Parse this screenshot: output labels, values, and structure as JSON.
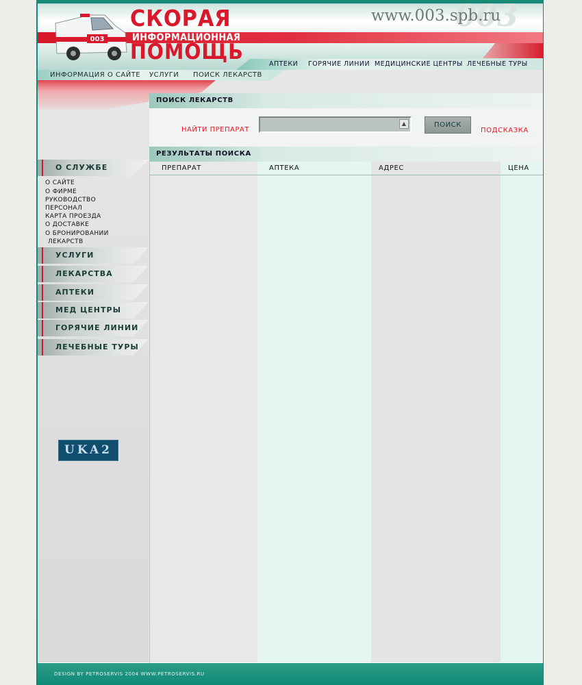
{
  "header": {
    "logo_top": "СКОРАЯ",
    "logo_middle": "ИНФОРМАЦИОННАЯ",
    "logo_bottom": "ПОМОЩЬ",
    "ambulance_number": "003",
    "site_url": "www.003.spb.ru",
    "url_watermark": "003",
    "topnav": [
      "АПТЕКИ",
      "ГОРЯЧИЕ ЛИНИИ",
      "МЕДИЦИНСКИЕ ЦЕНТРЫ",
      "ЛЕЧЕБНЫЕ ТУРЫ"
    ]
  },
  "subnav": [
    "ИНФОРМАЦИЯ О САЙТЕ",
    "УСЛУГИ",
    "ПОИСК ЛЕКАРСТВ"
  ],
  "sidebar": {
    "service_heading": "О СЛУЖБЕ",
    "service_links": [
      "О САЙТЕ",
      "О ФИРМЕ",
      "РУКОВОДСТВО",
      "ПЕРСОНАЛ",
      "КАРТА ПРОЕЗДА",
      "О ДОСТАВКЕ",
      "О БРОНИРОВАНИИ",
      "ЛЕКАРСТВ"
    ],
    "sections": [
      "УСЛУГИ",
      "ЛЕКАРСТВА",
      "АПТЕКИ",
      "МЕД ЦЕНТРЫ",
      "ГОРЯЧИЕ ЛИНИИ",
      "ЛЕЧЕБНЫЕ ТУРЫ"
    ],
    "badge": "UKA2"
  },
  "search": {
    "title": "ПОИСК ЛЕКАРСТВ",
    "find_label": "НАЙТИ ПРЕПАРАТ",
    "input_value": "",
    "button_label": "ПОИСК",
    "hint_link": "ПОДСКАЗКА"
  },
  "results": {
    "title": "РЕЗУЛЬТАТЫ ПОИСКА",
    "columns": [
      "ПРЕПАРАТ",
      "АПТЕКА",
      "АДРЕС",
      "ЦЕНА"
    ],
    "rows": []
  },
  "footer": {
    "credits": "DESIGN BY PETROSERVIS 2004 WWW.PETROSERVIS.RU"
  },
  "colors": {
    "brand_red": "#d9182b",
    "brand_teal": "#0f8a78",
    "pale_column": "#e4f5f2"
  }
}
